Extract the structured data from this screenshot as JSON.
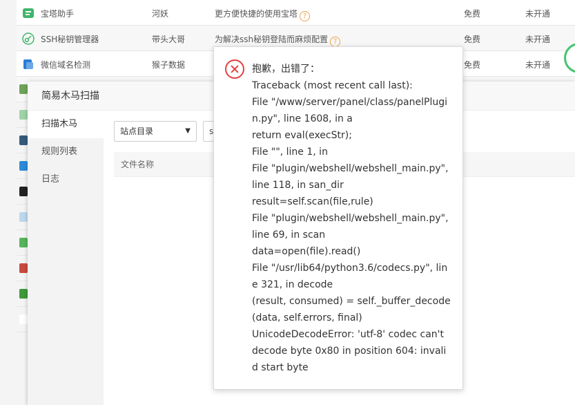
{
  "plugins": [
    {
      "name": "宝塔助手",
      "author": "河妖",
      "desc": "更方便快捷的使用宝塔",
      "price": "免费",
      "status": "未开通",
      "icon_color": "#3fb56b",
      "icon": "baota-icon"
    },
    {
      "name": "SSH秘钥管理器",
      "author": "带头大哥",
      "desc": "为解决ssh秘钥登陆而麻烦配置",
      "price": "免费",
      "status": "未开通",
      "icon_color": "#3fb56b",
      "icon": "key-icon"
    },
    {
      "name": "微信域名检测",
      "author": "猴子数据",
      "desc": "",
      "price": "免费",
      "status": "未开通",
      "icon_color": "#2b7cd3",
      "icon": "wechat-domain-icon"
    },
    {
      "name": "",
      "author": "",
      "desc": "",
      "price": "",
      "status": "",
      "icon_color": "#2b66c2",
      "icon": "plugin-icon"
    }
  ],
  "modal": {
    "title": "简易木马扫描",
    "tabs": [
      {
        "label": "扫描木马",
        "active": true
      },
      {
        "label": "规则列表",
        "active": false
      },
      {
        "label": "日志",
        "active": false
      }
    ],
    "select_value": "站点目录",
    "second_input": "s",
    "column_header": "文件名称"
  },
  "error": {
    "lines": [
      "抱歉，出错了：",
      "Traceback (most recent call last):",
      "File \"/www/server/panel/class/panelPlugin.py\", line 1608, in a",
      "return eval(execStr);",
      "File \"\", line 1, in",
      "File \"plugin/webshell/webshell_main.py\", line 118, in san_dir",
      "result=self.scan(file,rule)",
      "File \"plugin/webshell/webshell_main.py\", line 69, in scan",
      "data=open(file).read()",
      "File \"/usr/lib64/python3.6/codecs.py\", line 321, in decode",
      "(result, consumed) = self._buffer_decode(data, self.errors, final)",
      "UnicodeDecodeError: 'utf-8' codec can't decode byte 0x80 in position 604: invalid start byte"
    ]
  },
  "help_glyph": "?"
}
